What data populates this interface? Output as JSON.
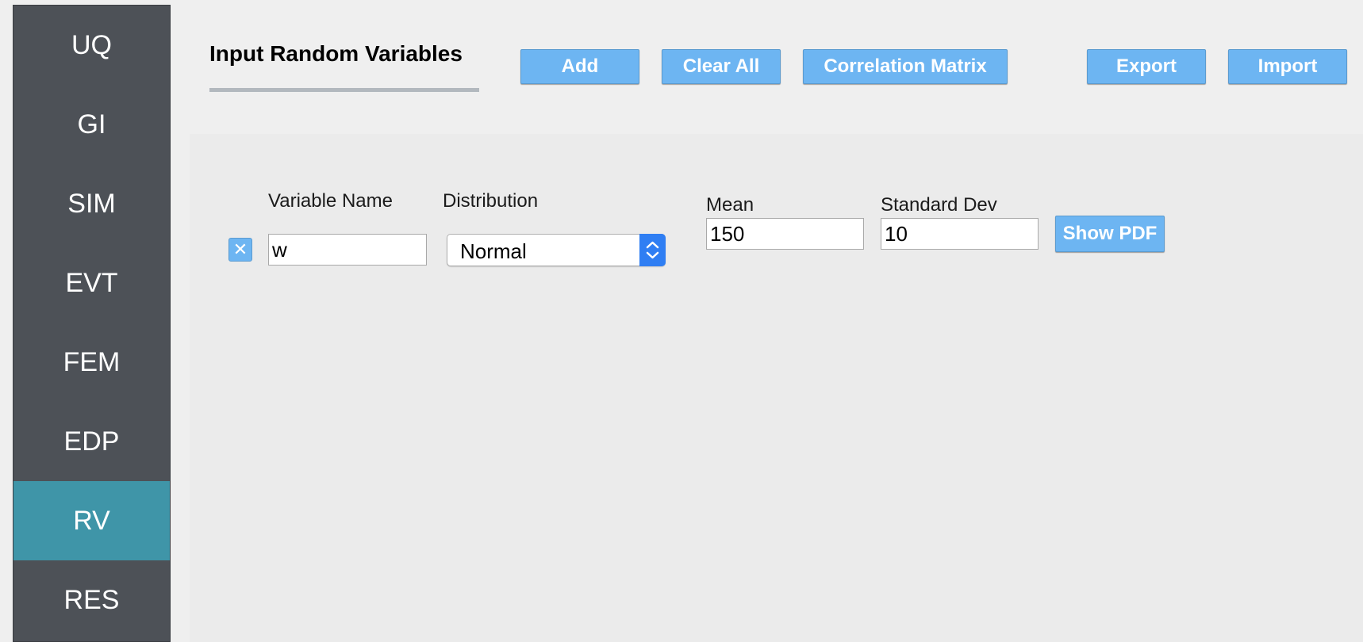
{
  "sidebar": {
    "items": [
      {
        "label": "UQ"
      },
      {
        "label": "GI"
      },
      {
        "label": "SIM"
      },
      {
        "label": "EVT"
      },
      {
        "label": "FEM"
      },
      {
        "label": "EDP"
      },
      {
        "label": "RV"
      },
      {
        "label": "RES"
      }
    ],
    "active": "RV",
    "active_color": "#3f95a8",
    "background_color": "#4d5157"
  },
  "header": {
    "title": "Input Random Variables",
    "buttons": {
      "add": "Add",
      "clear_all": "Clear All",
      "correlation_matrix": "Correlation Matrix",
      "export": "Export",
      "import": "Import"
    },
    "button_color": "#6db5f2"
  },
  "variables": {
    "headers": {
      "name": "Variable Name",
      "distribution": "Distribution",
      "mean": "Mean",
      "std_dev": "Standard Dev"
    },
    "rows": [
      {
        "remove_icon": "close-icon",
        "name": "w",
        "distribution": "Normal",
        "mean": "150",
        "std_dev": "10",
        "show_pdf_label": "Show PDF"
      }
    ]
  }
}
